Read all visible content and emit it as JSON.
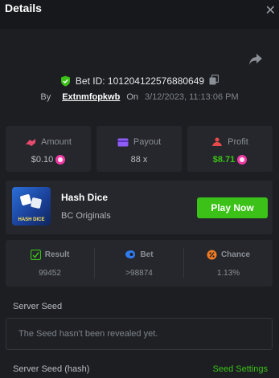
{
  "header": {
    "title": "Details"
  },
  "bet": {
    "id_text": "Bet ID: 101204122576880649",
    "by": "By",
    "user": "Extnmfopkwb",
    "on": "On",
    "date": "3/12/2023, 11:13:06 PM"
  },
  "stats": {
    "amount": {
      "label": "Amount",
      "value": "$0.10"
    },
    "payout": {
      "label": "Payout",
      "value": "88 x"
    },
    "profit": {
      "label": "Profit",
      "value": "$8.71"
    }
  },
  "game": {
    "name": "Hash Dice",
    "provider": "BC Originals",
    "thumb_text": "HASH DICE",
    "play_label": "Play Now"
  },
  "result": {
    "result": {
      "label": "Result",
      "value": "99452"
    },
    "bet": {
      "label": "Bet",
      "value": ">98874"
    },
    "chance": {
      "label": "Chance",
      "value": "1.13%"
    }
  },
  "server_seed": {
    "label": "Server Seed",
    "message": "The Seed hasn't been revealed yet."
  },
  "server_seed_hash": {
    "label": "Server Seed (hash)",
    "settings_label": "Seed Settings"
  },
  "colors": {
    "accent_green": "#3bc117",
    "amount_icon": "#e84a6f",
    "payout_icon": "#8f5cf7",
    "profit_icon": "#e84a4a",
    "coin": "#f03aa3",
    "chance_icon": "#f07a24",
    "bet_icon": "#2f7bf0"
  }
}
